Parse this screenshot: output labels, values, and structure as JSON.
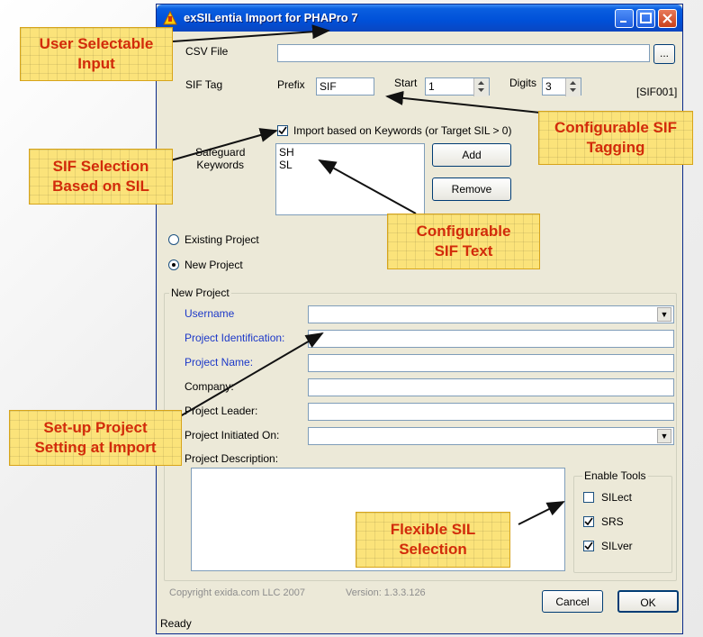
{
  "window": {
    "title": "exSILentia Import for PHAPro 7"
  },
  "csv": {
    "label": "CSV File",
    "value": "",
    "browse_label": "..."
  },
  "sif_tag": {
    "label": "SIF Tag",
    "prefix_label": "Prefix",
    "prefix_value": "SIF",
    "start_label": "Start",
    "start_value": "1",
    "digits_label": "Digits",
    "digits_value": "3",
    "preview": "[SIF001]"
  },
  "keywords": {
    "checkbox_label": "Import based on Keywords (or Target SIL > 0)",
    "checked": true,
    "label_line1": "Safeguard",
    "label_line2": "Keywords",
    "items": [
      "SH",
      "SL"
    ],
    "add_label": "Add",
    "remove_label": "Remove"
  },
  "project_mode": {
    "existing_label": "Existing Project",
    "new_label": "New Project",
    "selected": "new"
  },
  "new_project": {
    "group_title": "New Project",
    "username_label": "Username",
    "project_id_label": "Project Identification:",
    "project_name_label": "Project Name:",
    "company_label": "Company:",
    "leader_label": "Project Leader:",
    "initiated_label": "Project Initiated On:",
    "description_label": "Project Description:"
  },
  "tools": {
    "group_title": "Enable Tools",
    "items": [
      {
        "label": "SILect",
        "checked": false
      },
      {
        "label": "SRS",
        "checked": true
      },
      {
        "label": "SILver",
        "checked": true
      }
    ]
  },
  "footer": {
    "copyright": "Copyright exida.com LLC 2007",
    "version": "Version: 1.3.3.126",
    "cancel_label": "Cancel",
    "ok_label": "OK",
    "status": "Ready"
  },
  "callouts": {
    "user_input_line1": "User Selectable",
    "user_input_line2": "Input",
    "sif_tagging_line1": "Configurable SIF",
    "sif_tagging_line2": "Tagging",
    "sif_selection_line1": "SIF Selection",
    "sif_selection_line2": "Based on SIL",
    "sif_text_line1": "Configurable",
    "sif_text_line2": "SIF Text",
    "setup_line1": "Set-up Project",
    "setup_line2": "Setting at Import",
    "flexible_line1": "Flexible SIL",
    "flexible_line2": "Selection"
  },
  "colors": {
    "titlebar": "#0050d8",
    "callout_fill": "#fbe37a",
    "callout_text": "#d22b0a",
    "label_blue": "#1c38c8"
  }
}
